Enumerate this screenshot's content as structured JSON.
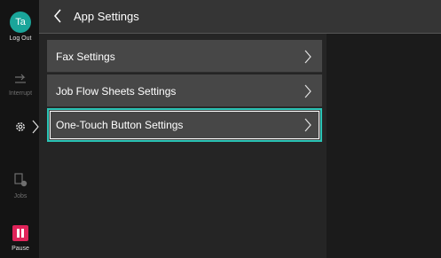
{
  "rail": {
    "avatar_initials": "Ta",
    "logout_label": "Log Out",
    "interrupt_label": "Interrupt",
    "jobs_label": "Jobs",
    "pause_label": "Pause"
  },
  "header": {
    "title": "App Settings"
  },
  "menu": {
    "items": [
      {
        "label": "Fax Settings",
        "selected": false
      },
      {
        "label": "Job Flow Sheets Settings",
        "selected": false
      },
      {
        "label": "One-Touch Button Settings",
        "selected": true
      }
    ]
  },
  "colors": {
    "accent": "#2bc4b6",
    "avatar": "#1aa59a",
    "pause": "#e0245a"
  },
  "icons": [
    "back-arrow-icon",
    "interrupt-icon",
    "gear-icon",
    "jobs-icon",
    "pause-icon",
    "chevron-right-icon"
  ]
}
